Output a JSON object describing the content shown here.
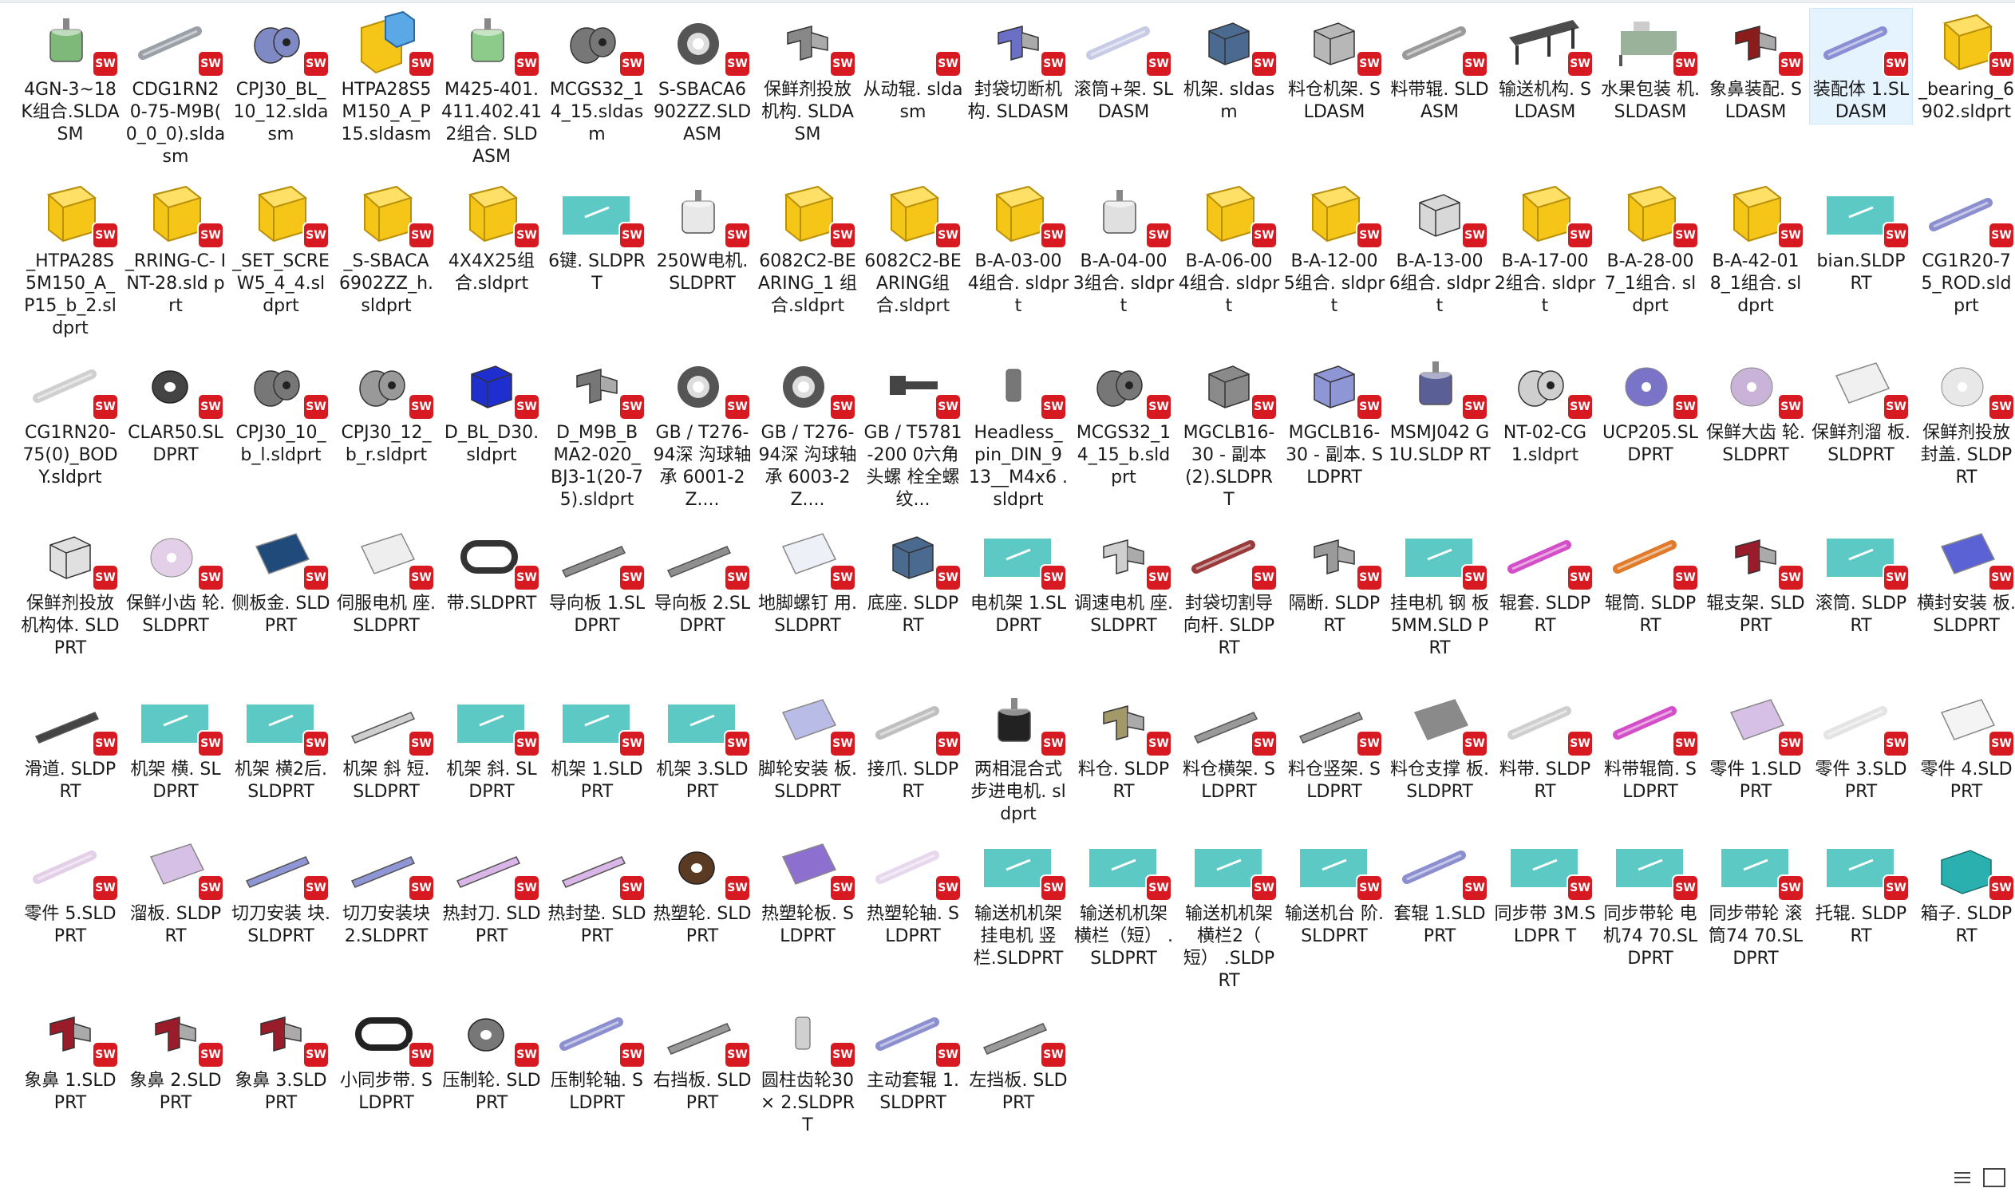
{
  "files": [
    {
      "name": "4GN-3~18 K组合.SLDASM",
      "icon": "assembly-motor",
      "color": "#7fb97a"
    },
    {
      "name": "CDG1RN2 0-75-M9B( 0_0_0).slda sm",
      "icon": "assembly-cylinder",
      "color": "#9aa0a6"
    },
    {
      "name": "CPJ30_BL_ 10_12.slda sm",
      "icon": "assembly-coupling",
      "color": "#7f89c4"
    },
    {
      "name": "HTPA28S5 M150_A_P 15.sldasm",
      "icon": "assembly-folder-cube",
      "color": "#f5c518"
    },
    {
      "name": "M425-401. 411.402.41 2组合. SLDASM",
      "icon": "assembly-motor",
      "color": "#8ccb8a"
    },
    {
      "name": "MCGS32_1 4_15.sldas m",
      "icon": "assembly-coupling",
      "color": "#777777"
    },
    {
      "name": "S-SBACA6 902ZZ.SLD ASM",
      "icon": "assembly-bearing",
      "color": "#555555"
    },
    {
      "name": "保鲜剂投放 机构. SLDASM",
      "icon": "assembly-mechanism",
      "color": "#888888"
    },
    {
      "name": "从动辊. sldasm",
      "icon": "assembly-empty",
      "color": "#ffffff"
    },
    {
      "name": "封袋切断机 构. SLDASM",
      "icon": "assembly-mechanism",
      "color": "#6b6fc6"
    },
    {
      "name": "滚筒+架. SLDASM",
      "icon": "assembly-cylinder",
      "color": "#c8cbe6"
    },
    {
      "name": "机架. sldasm",
      "icon": "assembly-frame",
      "color": "#4a6b8f"
    },
    {
      "name": "料仓机架. SLDASM",
      "icon": "assembly-frame",
      "color": "#b7b7b7"
    },
    {
      "name": "料带辊. SLDASM",
      "icon": "assembly-rod",
      "color": "#9a9a9a"
    },
    {
      "name": "输送机构. SLDASM",
      "icon": "assembly-conveyor",
      "color": "#4c4c4c"
    },
    {
      "name": "水果包装 机. SLDASM",
      "icon": "assembly-machine",
      "color": "#7f9f7f"
    },
    {
      "name": "象鼻装配. SLDASM",
      "icon": "assembly-mechanism",
      "color": "#8a1c1c"
    },
    {
      "name": "装配体 1.SLDASM",
      "icon": "assembly-rod",
      "color": "#8a8fd4",
      "selected": true
    },
    {
      "name": "_bearing_6 902.sldprt",
      "icon": "folder-part",
      "color": "#f5c518"
    },
    {
      "name": "_HTPA28S 5M150_A_ P15_b_2.sl dprt",
      "icon": "folder-part",
      "color": "#f5c518"
    },
    {
      "name": "_RRING-C- INT-28.sld prt",
      "icon": "folder-part",
      "color": "#f5c518"
    },
    {
      "name": "_SET_SCRE W5_4_4.sl dprt",
      "icon": "folder-part",
      "color": "#f5c518"
    },
    {
      "name": "_S-SBACA 6902ZZ_h. sldprt",
      "icon": "folder-part",
      "color": "#f5c518"
    },
    {
      "name": "4X4X25组 合.sldprt",
      "icon": "folder-part",
      "color": "#f5c518"
    },
    {
      "name": "6键. SLDPRT",
      "icon": "part-plate",
      "color": "#5cc9c4"
    },
    {
      "name": "250W电机. SLDPRT",
      "icon": "part-motor",
      "color": "#e8e8e8"
    },
    {
      "name": "6082C2-BE ARING_1 组合.sldprt",
      "icon": "folder-part",
      "color": "#f5c518"
    },
    {
      "name": "6082C2-BE ARING组 合.sldprt",
      "icon": "folder-part",
      "color": "#f5c518"
    },
    {
      "name": "B-A-03-00 4组合. sldprt",
      "icon": "folder-part",
      "color": "#f5c518"
    },
    {
      "name": "B-A-04-00 3组合. sldprt",
      "icon": "part-motor",
      "color": "#e0e0e0"
    },
    {
      "name": "B-A-06-00 4组合. sldprt",
      "icon": "folder-part",
      "color": "#f5c518"
    },
    {
      "name": "B-A-12-00 5组合. sldprt",
      "icon": "folder-part",
      "color": "#f5c518"
    },
    {
      "name": "B-A-13-00 6组合. sldprt",
      "icon": "part-block",
      "color": "#d8d8d8"
    },
    {
      "name": "B-A-17-00 2组合. sldprt",
      "icon": "folder-part",
      "color": "#f5c518"
    },
    {
      "name": "B-A-28-00 7_1组合. sldprt",
      "icon": "folder-part",
      "color": "#f5c518"
    },
    {
      "name": "B-A-42-01 8_1组合. sldprt",
      "icon": "folder-part",
      "color": "#f5c518"
    },
    {
      "name": "bian.SLDP RT",
      "icon": "part-plate",
      "color": "#5cc9c4"
    },
    {
      "name": "CG1R20-7 5_ROD.sld prt",
      "icon": "part-rod",
      "color": "#8c8fcf"
    },
    {
      "name": "CG1RN20- 75(0)_BOD Y.sldprt",
      "icon": "part-rod",
      "color": "#cfcfcf"
    },
    {
      "name": "CLAR50.SL DPRT",
      "icon": "part-wheel",
      "color": "#444444"
    },
    {
      "name": "CPJ30_10_ b_l.sldprt",
      "icon": "part-coupling",
      "color": "#777777"
    },
    {
      "name": "CPJ30_12_ b_r.sldprt",
      "icon": "part-coupling",
      "color": "#999999"
    },
    {
      "name": "D_BL_D30. sldprt",
      "icon": "part-block",
      "color": "#1f2ecf"
    },
    {
      "name": "D_M9B_B MA2-020_ BJ3-1(20-7 5).sldprt",
      "icon": "part-bracket",
      "color": "#777777"
    },
    {
      "name": "GB / T276-94深 沟球轴承 6001-2Z....",
      "icon": "part-bearing",
      "color": "#555555"
    },
    {
      "name": "GB / T276-94深 沟球轴承 6003-2Z....",
      "icon": "part-bearing",
      "color": "#555555"
    },
    {
      "name": "GB / T5781-200 0六角头螺 栓全螺纹...",
      "icon": "part-bolt",
      "color": "#444444"
    },
    {
      "name": "Headless_ pin_DIN_9 13__M4x6 .sldprt",
      "icon": "part-pin",
      "color": "#777777"
    },
    {
      "name": "MCGS32_1 4_15_b.sld prt",
      "icon": "part-coupling",
      "color": "#777777"
    },
    {
      "name": "MGCLB16- 30 - 副本 (2).SLDPR T",
      "icon": "part-block",
      "color": "#8a8a8a"
    },
    {
      "name": "MGCLB16- 30 - 副本. SLDPRT",
      "icon": "part-block",
      "color": "#8f96d6"
    },
    {
      "name": "MSMJ042 G1U.SLDP RT",
      "icon": "part-motor",
      "color": "#5a5f96"
    },
    {
      "name": "NT-02-CG 1.sldprt",
      "icon": "part-coupling",
      "color": "#cfcfcf"
    },
    {
      "name": "UCP205.SL DPRT",
      "icon": "part-disc",
      "color": "#7a74c9"
    },
    {
      "name": "保鲜大齿 轮.SLDPRT",
      "icon": "part-disc",
      "color": "#c9b3d9"
    },
    {
      "name": "保鲜剂溜 板.SLDPRT",
      "icon": "part-sheet",
      "color": "#f0f0f0"
    },
    {
      "name": "保鲜剂投放 封盖. SLDPRT",
      "icon": "part-disc",
      "color": "#e8e8e8"
    },
    {
      "name": "保鲜剂投放 机构体. SLDPRT",
      "icon": "part-block",
      "color": "#e0e0e0"
    },
    {
      "name": "保鲜小齿 轮.SLDPRT",
      "icon": "part-disc",
      "color": "#e4cfe8"
    },
    {
      "name": "侧板金. SLDPRT",
      "icon": "part-sheet",
      "color": "#1f4a7a"
    },
    {
      "name": "伺服电机 座.SLDPRT",
      "icon": "part-sheet",
      "color": "#eeeeee"
    },
    {
      "name": "带.SLDPRT",
      "icon": "part-belt",
      "color": "#333333"
    },
    {
      "name": "导向板 1.SLDPRT",
      "icon": "part-rail",
      "color": "#8f8f8f"
    },
    {
      "name": "导向板 2.SLDPRT",
      "icon": "part-rail",
      "color": "#8f8f8f"
    },
    {
      "name": "地脚螺钉 用.SLDPRT",
      "icon": "part-sheet",
      "color": "#eef0f8"
    },
    {
      "name": "底座. SLDPRT",
      "icon": "part-frame",
      "color": "#4a6b8f"
    },
    {
      "name": "电机架 1.SLDPRT",
      "icon": "part-plate",
      "color": "#5cc9c4"
    },
    {
      "name": "调速电机 座.SLDPRT",
      "icon": "part-bracket",
      "color": "#cfcfcf"
    },
    {
      "name": "封袋切割导 向杆. SLDPRT",
      "icon": "part-rod",
      "color": "#9a3b3b"
    },
    {
      "name": "隔断. SLDPRT",
      "icon": "part-bracket",
      "color": "#9a9a9a"
    },
    {
      "name": "挂电机 钢 板 5MM.SLD PRT",
      "icon": "part-plate",
      "color": "#5cc9c4"
    },
    {
      "name": "辊套. SLDPRT",
      "icon": "part-rod",
      "color": "#d34fc9"
    },
    {
      "name": "辊筒. SLDPRT",
      "icon": "part-rod",
      "color": "#e07a2d"
    },
    {
      "name": "辊支架. SLDPRT",
      "icon": "part-bracket",
      "color": "#9a1c2a"
    },
    {
      "name": "滚筒. SLDPRT",
      "icon": "part-plate",
      "color": "#5cc9c4"
    },
    {
      "name": "横封安装 板.SLDPRT",
      "icon": "part-sheet",
      "color": "#5a62d4"
    },
    {
      "name": "滑道. SLDPRT",
      "icon": "part-rail",
      "color": "#444444"
    },
    {
      "name": "机架 横. SLDPRT",
      "icon": "part-plate",
      "color": "#5cc9c4"
    },
    {
      "name": "机架 横2后. SLDPRT",
      "icon": "part-plate",
      "color": "#5cc9c4"
    },
    {
      "name": "机架 斜 短. SLDPRT",
      "icon": "part-rail",
      "color": "#cfcfcf"
    },
    {
      "name": "机架 斜. SLDPRT",
      "icon": "part-plate",
      "color": "#5cc9c4"
    },
    {
      "name": "机架 1.SLDPRT",
      "icon": "part-plate",
      "color": "#5cc9c4"
    },
    {
      "name": "机架 3.SLDPRT",
      "icon": "part-plate",
      "color": "#5cc9c4"
    },
    {
      "name": "脚轮安装 板.SLDPRT",
      "icon": "part-sheet",
      "color": "#b9bce6"
    },
    {
      "name": "接爪. SLDPRT",
      "icon": "part-rod",
      "color": "#bfbfbf"
    },
    {
      "name": "两相混合式 步进电机. sldprt",
      "icon": "part-motor",
      "color": "#222222"
    },
    {
      "name": "料仓. SLDPRT",
      "icon": "part-bracket",
      "color": "#a39868"
    },
    {
      "name": "料仓横架. SLDPRT",
      "icon": "part-rail",
      "color": "#9a9a9a"
    },
    {
      "name": "料仓竖架. SLDPRT",
      "icon": "part-rail",
      "color": "#9a9a9a"
    },
    {
      "name": "料仓支撑 板.SLDPRT",
      "icon": "part-sheet",
      "color": "#8a8a8a"
    },
    {
      "name": "料带. SLDPRT",
      "icon": "part-rod",
      "color": "#cfcfcf"
    },
    {
      "name": "料带辊筒. SLDPRT",
      "icon": "part-rod",
      "color": "#d34fc9"
    },
    {
      "name": "零件 1.SLDPRT",
      "icon": "part-sheet",
      "color": "#d6c0e6"
    },
    {
      "name": "零件 3.SLDPRT",
      "icon": "part-rod",
      "color": "#e4e4e4"
    },
    {
      "name": "零件 4.SLDPRT",
      "icon": "part-sheet",
      "color": "#f4f4f4"
    },
    {
      "name": "零件 5.SLDPRT",
      "icon": "part-rod",
      "color": "#e4cfe8"
    },
    {
      "name": "溜板. SLDPRT",
      "icon": "part-sheet",
      "color": "#d6c0e6"
    },
    {
      "name": "切刀安装 块.SLDPRT",
      "icon": "part-rail",
      "color": "#8f96d6"
    },
    {
      "name": "切刀安装块 2.SLDPRT",
      "icon": "part-rail",
      "color": "#8f96d6"
    },
    {
      "name": "热封刀. SLDPRT",
      "icon": "part-rail",
      "color": "#dab6e8"
    },
    {
      "name": "热封垫. SLDPRT",
      "icon": "part-rail",
      "color": "#dab6e8"
    },
    {
      "name": "热塑轮. SLDPRT",
      "icon": "part-wheel",
      "color": "#5a3a22"
    },
    {
      "name": "热塑轮板. SLDPRT",
      "icon": "part-sheet",
      "color": "#8c6fcf"
    },
    {
      "name": "热塑轮轴. SLDPRT",
      "icon": "part-rod",
      "color": "#e8d8ee"
    },
    {
      "name": "输送机机架 挂电机 竖 栏.SLDPRT",
      "icon": "part-plate",
      "color": "#5cc9c4"
    },
    {
      "name": "输送机机架 横栏（短） .SLDPRT",
      "icon": "part-plate",
      "color": "#5cc9c4"
    },
    {
      "name": "输送机机架 横栏2（ 短） .SLDPRT",
      "icon": "part-plate",
      "color": "#5cc9c4"
    },
    {
      "name": "输送机台 阶.SLDPRT",
      "icon": "part-plate",
      "color": "#5cc9c4"
    },
    {
      "name": "套辊 1.SLDPRT",
      "icon": "part-rod",
      "color": "#8c8fcf"
    },
    {
      "name": "同步带 3M.SLDPR T",
      "icon": "part-plate",
      "color": "#5cc9c4"
    },
    {
      "name": "同步带轮 电机74 70.SLDPRT",
      "icon": "part-plate",
      "color": "#5cc9c4"
    },
    {
      "name": "同步带轮 滚筒74 70.SLDPRT",
      "icon": "part-plate",
      "color": "#5cc9c4"
    },
    {
      "name": "托辊. SLDPRT",
      "icon": "part-plate",
      "color": "#5cc9c4"
    },
    {
      "name": "箱子. SLDPRT",
      "icon": "part-box",
      "color": "#2bb0b0"
    },
    {
      "name": "象鼻 1.SLDPRT",
      "icon": "part-bracket",
      "color": "#9a1c2a"
    },
    {
      "name": "象鼻 2.SLDPRT",
      "icon": "part-bracket",
      "color": "#9a1c2a"
    },
    {
      "name": "象鼻 3.SLDPRT",
      "icon": "part-bracket",
      "color": "#9a1c2a"
    },
    {
      "name": "小同步带. SLDPRT",
      "icon": "part-belt",
      "color": "#222222"
    },
    {
      "name": "压制轮. SLDPRT",
      "icon": "part-wheel",
      "color": "#777777"
    },
    {
      "name": "压制轮轴. SLDPRT",
      "icon": "part-rod",
      "color": "#8c8fcf"
    },
    {
      "name": "右挡板. SLDPRT",
      "icon": "part-rail",
      "color": "#9a9a9a"
    },
    {
      "name": "圆柱齿轮30 × 2.SLDPRT",
      "icon": "part-pin",
      "color": "#d0d0d0"
    },
    {
      "name": "主动套辊 1.SLDPRT",
      "icon": "part-rod",
      "color": "#8c8fcf"
    },
    {
      "name": "左挡板. SLDPRT",
      "icon": "part-rail",
      "color": "#9a9a9a"
    }
  ],
  "badge": {
    "text": "SW",
    "color": "#d71921"
  },
  "view_controls": [
    {
      "name": "details-view-button",
      "icon": "details-view-icon"
    },
    {
      "name": "large-icons-view-button",
      "icon": "large-icons-view-icon"
    }
  ]
}
